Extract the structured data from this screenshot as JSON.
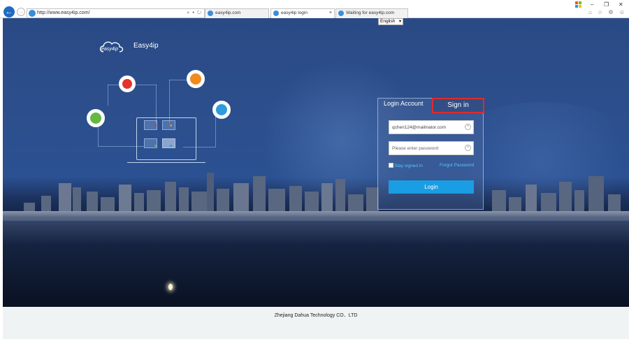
{
  "browser": {
    "url": "http://www.easy4ip.com/",
    "address_tools": "⌕ ▾ ↻",
    "tabs": [
      {
        "label": "easy4ip.com",
        "active": false
      },
      {
        "label": "easy4ip login",
        "active": true
      },
      {
        "label": "Waiting for easy4ip.com",
        "active": false
      }
    ],
    "tab_close": "×",
    "window_controls": {
      "minimize": "‒",
      "restore": "❐",
      "close": "✕"
    },
    "toolbar_icons": "⌂ ☆ ⚙ ☺"
  },
  "language_select": {
    "value": "English"
  },
  "brand": {
    "name": "Easy4ip",
    "logo_text": "easy4ip"
  },
  "login": {
    "tab_account_label": "Login Account",
    "tab_signin_label": "Sign in",
    "username_value": "qchen124@mailinator.com",
    "password_placeholder": "Please enter password",
    "stay_signed_in_label": "Stay signed in",
    "forgot_password_label": "Forgot Password",
    "login_button_label": "Login",
    "clear_icon_glyph": "×"
  },
  "footer": {
    "company": "Zhejiang Dahua Technology CO．LTD"
  },
  "colors": {
    "accent": "#1a9de3",
    "highlight_border": "#e02b2b",
    "link": "#5bc0ff"
  }
}
